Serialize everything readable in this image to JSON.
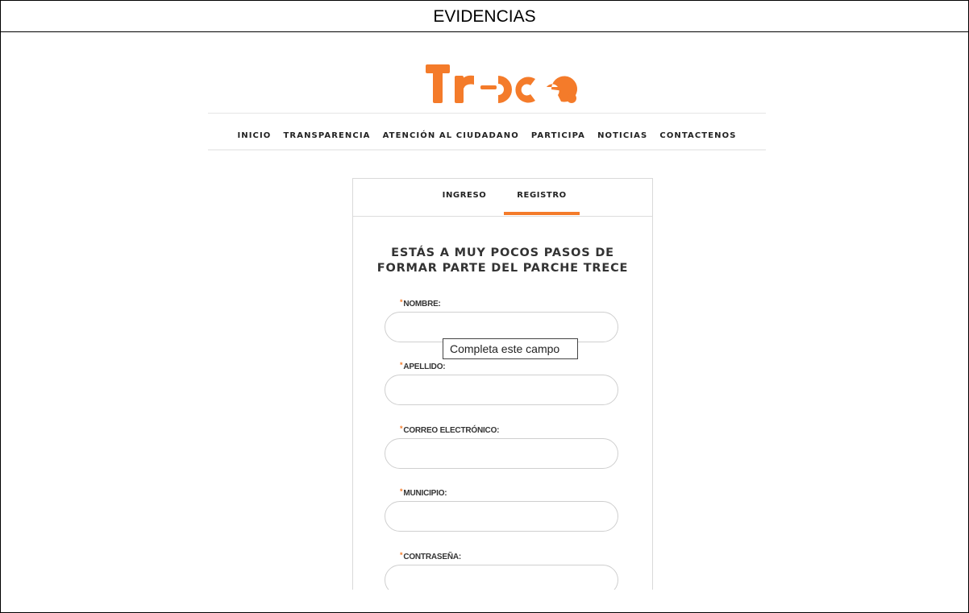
{
  "document": {
    "header": "EVIDENCIAS"
  },
  "site": {
    "logo_text": "Tr=ce.",
    "brand_color": "#f47b2a",
    "nav": [
      "INICIO",
      "TRANSPARENCIA",
      "ATENCIÓN AL CIUDADANO",
      "PARTICIPA",
      "NOTICIAS",
      "CONTACTENOS"
    ]
  },
  "form": {
    "tabs": {
      "login": "INGRESO",
      "register": "REGISTRO",
      "active": "REGISTRO"
    },
    "heading_line1": "ESTÁS A MUY POCOS PASOS DE",
    "heading_line2": "FORMAR PARTE DEL PARCHE TRECE",
    "required_marker": "*",
    "fields": {
      "nombre": {
        "label": "NOMBRE:",
        "value": ""
      },
      "apellido": {
        "label": "APELLIDO:",
        "value": ""
      },
      "correo": {
        "label": "CORREO ELECTRÓNICO:",
        "value": ""
      },
      "municipio": {
        "label": "MUNICIPIO:",
        "value": ""
      },
      "contrasena": {
        "label": "CONTRASEÑA:",
        "value": ""
      }
    },
    "validation_tooltip": "Completa este campo"
  }
}
